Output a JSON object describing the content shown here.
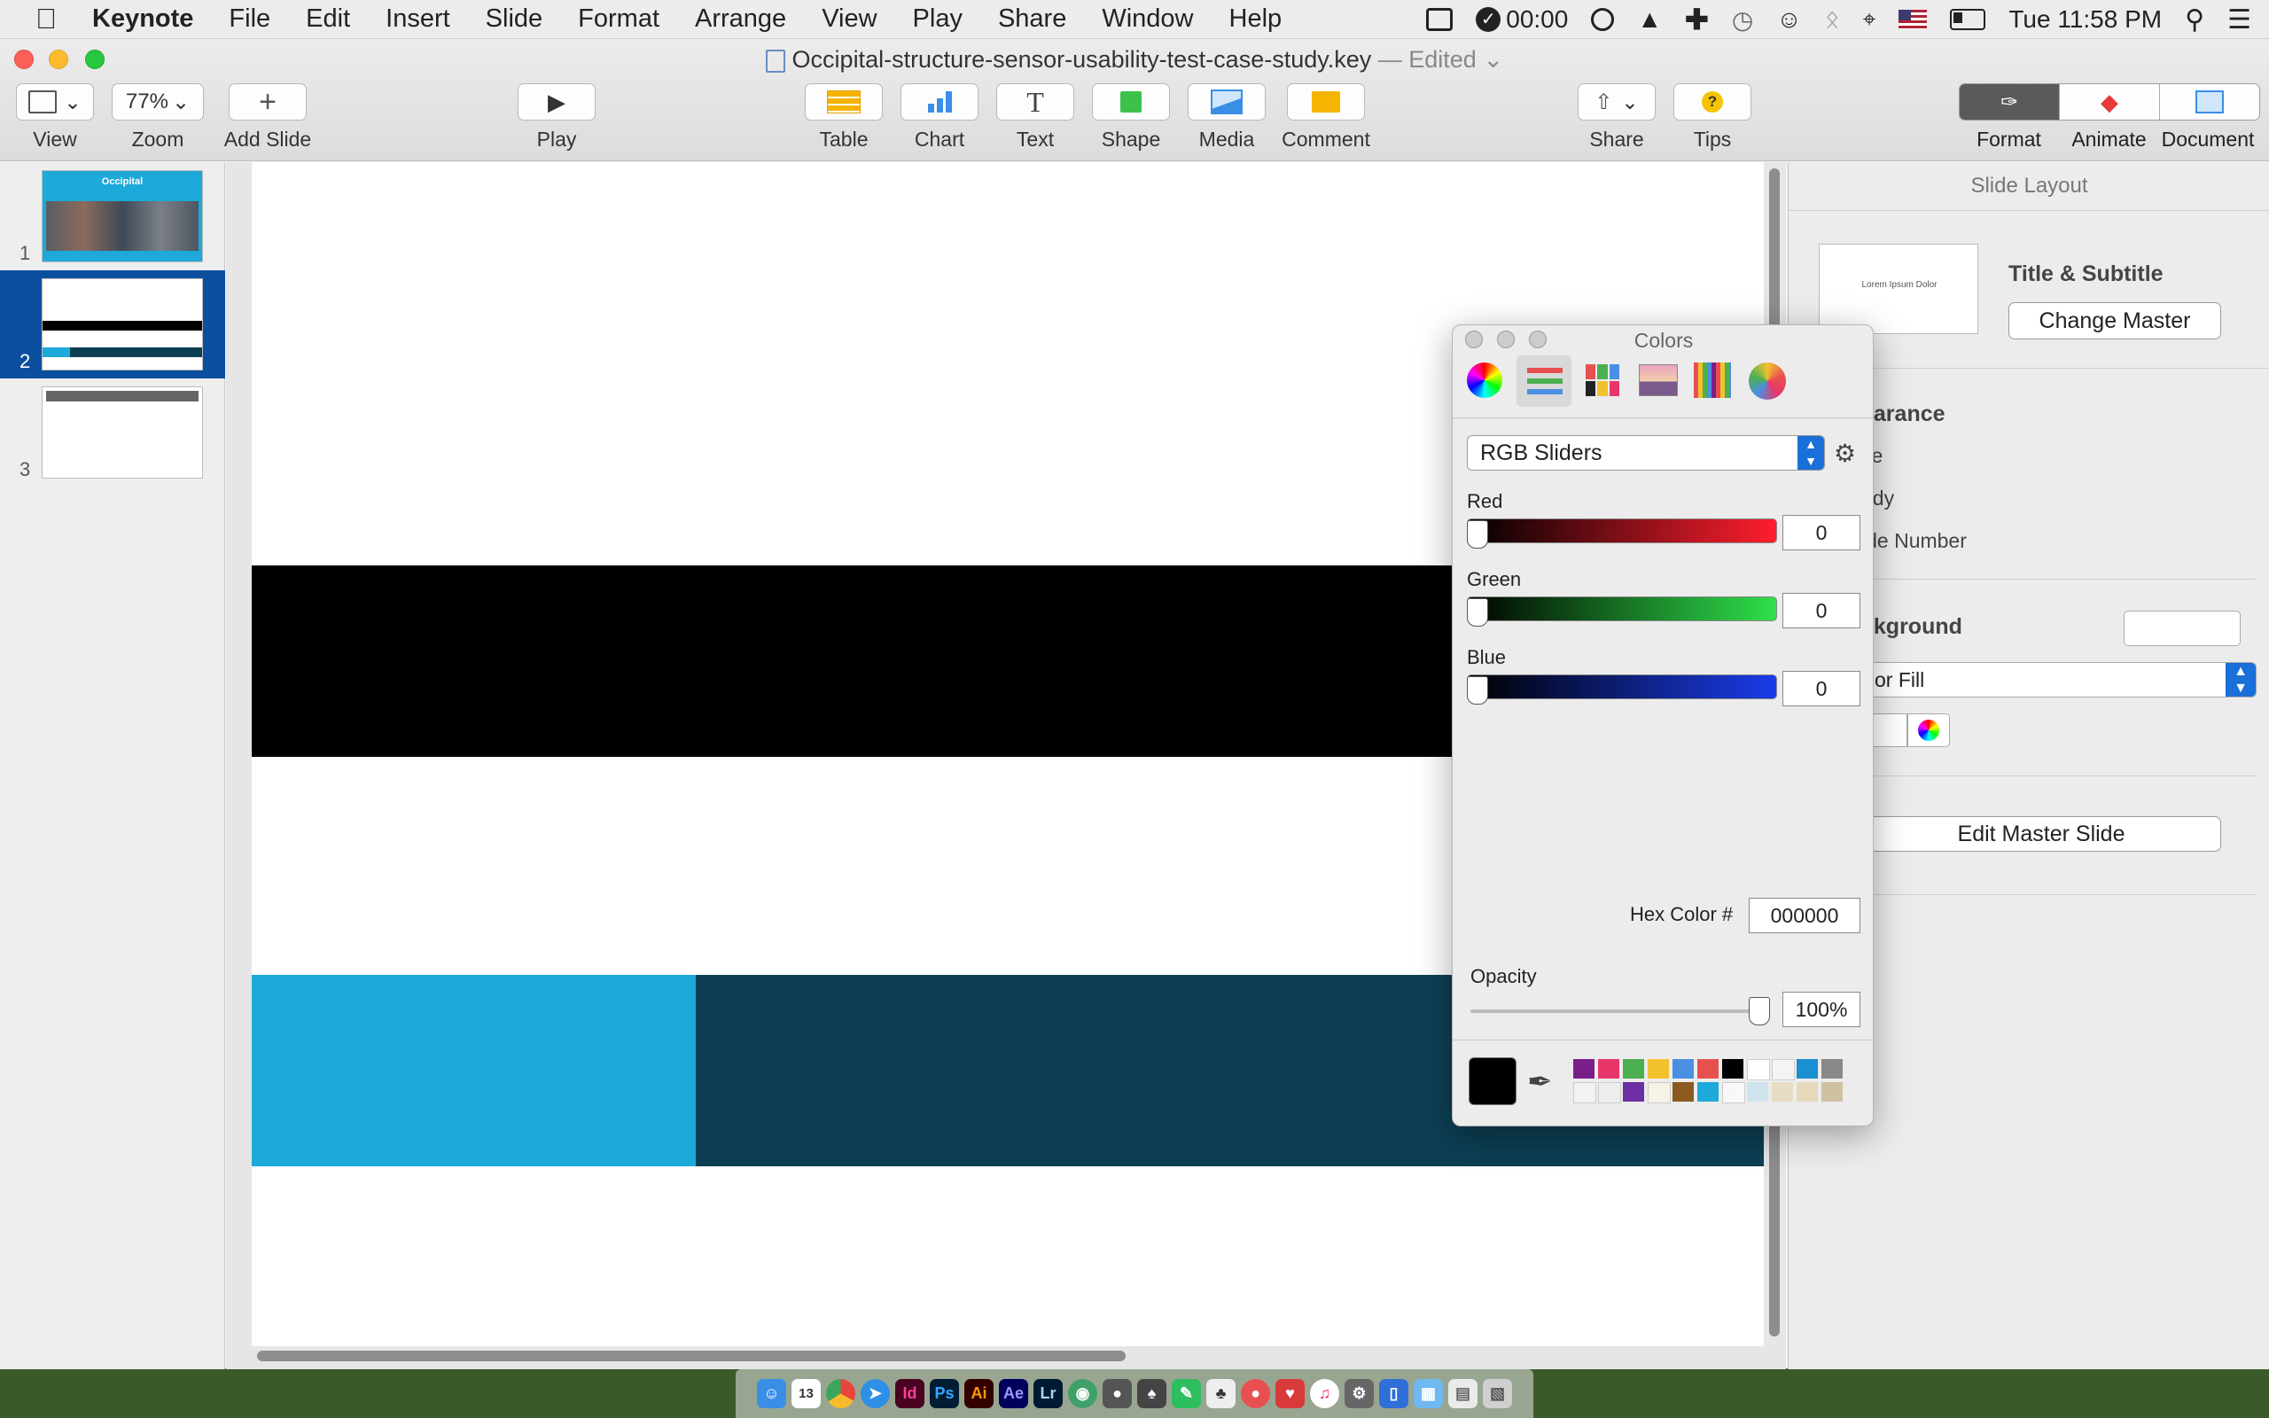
{
  "menubar": {
    "app": "Keynote",
    "items": [
      "File",
      "Edit",
      "Insert",
      "Slide",
      "Format",
      "Arrange",
      "View",
      "Play",
      "Share",
      "Window",
      "Help"
    ],
    "timer": "00:00",
    "clock": "Tue 11:58 PM"
  },
  "window": {
    "doc_name": "Occipital-structure-sensor-usability-test-case-study.key",
    "doc_state": "— Edited",
    "toolbar": {
      "view": "View",
      "zoom_value": "77%",
      "zoom": "Zoom",
      "add_slide": "Add Slide",
      "play": "Play",
      "table": "Table",
      "chart": "Chart",
      "text": "Text",
      "shape": "Shape",
      "media": "Media",
      "comment": "Comment",
      "share": "Share",
      "tips": "Tips",
      "format": "Format",
      "animate": "Animate",
      "document": "Document"
    }
  },
  "slides": {
    "numbers": [
      "1",
      "2",
      "3"
    ],
    "slide1_title": "Occipital",
    "selected": 2
  },
  "slide_colors": {
    "black_band": "#000000",
    "light_blue": "#1da9d9",
    "dark_teal": "#0d3f54"
  },
  "inspector": {
    "header": "Slide Layout",
    "master_thumb_text": "Lorem Ipsum Dolor",
    "master_name": "Title & Subtitle",
    "change_master": "Change Master",
    "appearance": "earance",
    "title_cb": "tle",
    "body_cb": "ody",
    "slide_number_cb": "ide Number",
    "background": "ckground",
    "fill_type": "or Fill",
    "edit_master": "Edit Master Slide"
  },
  "colors_panel": {
    "title": "Colors",
    "mode": "RGB Sliders",
    "red_label": "Red",
    "red_value": "0",
    "green_label": "Green",
    "green_value": "0",
    "blue_label": "Blue",
    "blue_value": "0",
    "hex_label": "Hex Color #",
    "hex_value": "000000",
    "opacity_label": "Opacity",
    "opacity_value": "100%",
    "current_color": "#000000",
    "swatches_row1": [
      "#7a1f8a",
      "#e8366b",
      "#4caf50",
      "#f2c12e",
      "#4a90e2",
      "#e85050",
      "#000000",
      "#ffffff",
      "#f4f4f4",
      "#1a8fd1",
      "#888888"
    ],
    "swatches_row2": [
      "#f2f2f2",
      "#ededed",
      "#6b2fa3",
      "#f7f2e6",
      "#8a5a1e",
      "#1da9d9",
      "#f8f8f8",
      "#cfe3ef",
      "#e9dcc4",
      "#e6d8bb",
      "#cfc2a2"
    ]
  }
}
